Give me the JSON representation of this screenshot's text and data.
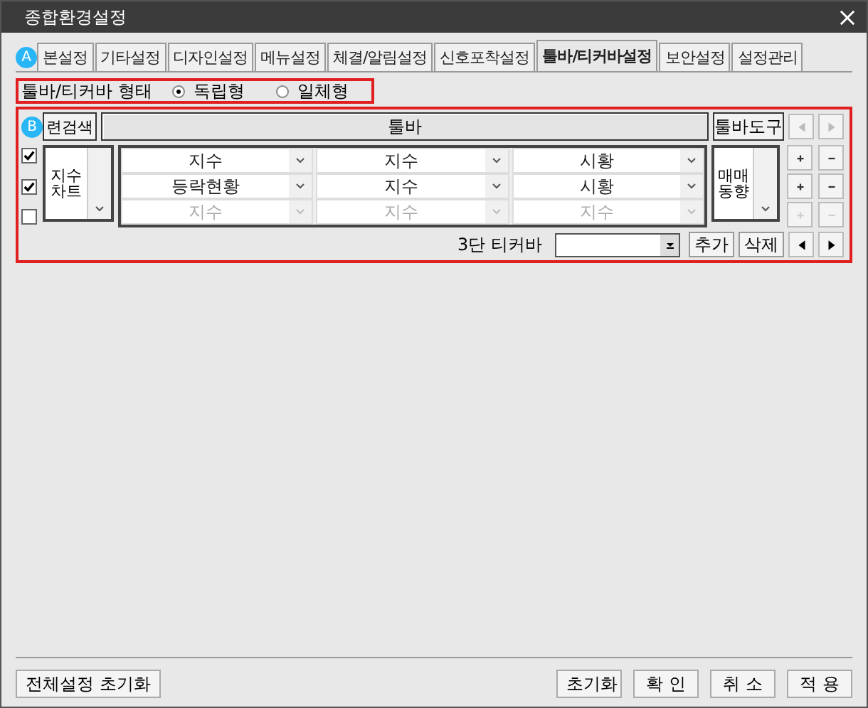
{
  "window": {
    "title": "종합환경설정"
  },
  "tabs": [
    {
      "label": "본설정",
      "selected": false,
      "badge": "A"
    },
    {
      "label": "기타설정",
      "selected": false
    },
    {
      "label": "디자인설정",
      "selected": false
    },
    {
      "label": "메뉴설정",
      "selected": false
    },
    {
      "label": "체결/알림설정",
      "selected": false
    },
    {
      "label": "신호포착설정",
      "selected": false
    },
    {
      "label": "툴바/티커바설정",
      "selected": true
    },
    {
      "label": "보안설정",
      "selected": false
    },
    {
      "label": "설정관리",
      "selected": false
    }
  ],
  "layout_option": {
    "label": "툴바/티커바 형태",
    "options": [
      {
        "label": "독립형",
        "selected": true
      },
      {
        "label": "일체형",
        "selected": false
      }
    ]
  },
  "toolbar_grid": {
    "badge": "B",
    "search_button": "련검색",
    "header": "툴바",
    "tools_header": "툴바도구",
    "left_combo": "지수 차트",
    "right_combo": "매매 동향",
    "rows": [
      {
        "checked": true,
        "cells": [
          "지수",
          "지수",
          "시황"
        ]
      },
      {
        "checked": true,
        "cells": [
          "등락현황",
          "지수",
          "시황"
        ]
      },
      {
        "checked": false,
        "cells": [
          "지수",
          "지수",
          "지수"
        ]
      }
    ]
  },
  "ticker": {
    "label": "3단 티커바",
    "add_button": "추가",
    "delete_button": "삭제"
  },
  "footer": {
    "reset_all": "전체설정 초기화",
    "buttons": [
      "초기화",
      "확 인",
      "취 소",
      "적 용"
    ]
  }
}
